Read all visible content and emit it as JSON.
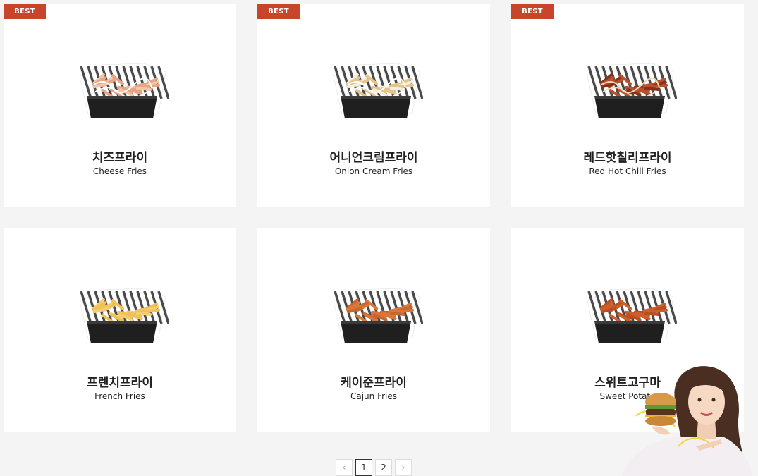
{
  "products": [
    {
      "badge": "BEST",
      "name_ko": "치즈프라이",
      "name_en": "Cheese Fries",
      "fry": "#e8a487",
      "topping": "#f3c6a8",
      "drizzle": "#ffffff"
    },
    {
      "badge": "BEST",
      "name_ko": "어니언크림프라이",
      "name_en": "Onion Cream Fries",
      "fry": "#e6c388",
      "topping": "#f5efe2",
      "drizzle": "#ffffff"
    },
    {
      "badge": "BEST",
      "name_ko": "레드핫칠리프라이",
      "name_en": "Red Hot Chili Fries",
      "fry": "#b8512e",
      "topping": "#8c2f19",
      "drizzle": "#f0d9b8"
    },
    {
      "badge": "",
      "name_ko": "프렌치프라이",
      "name_en": "French Fries",
      "fry": "#f0c05a",
      "topping": "#f5cf6f",
      "drizzle": ""
    },
    {
      "badge": "",
      "name_ko": "케이준프라이",
      "name_en": "Cajun Fries",
      "fry": "#d8773a",
      "topping": "#c9652e",
      "drizzle": ""
    },
    {
      "badge": "",
      "name_ko": "스위트고구마",
      "name_en": "Sweet Potato",
      "fry": "#cc5f2c",
      "topping": "#b84e22",
      "drizzle": ""
    }
  ],
  "pagination": {
    "prev": "‹",
    "pages": [
      "1",
      "2"
    ],
    "active": "1",
    "next": "›"
  },
  "colors": {
    "badge": "#c8442b",
    "background": "#f4f4f4"
  }
}
